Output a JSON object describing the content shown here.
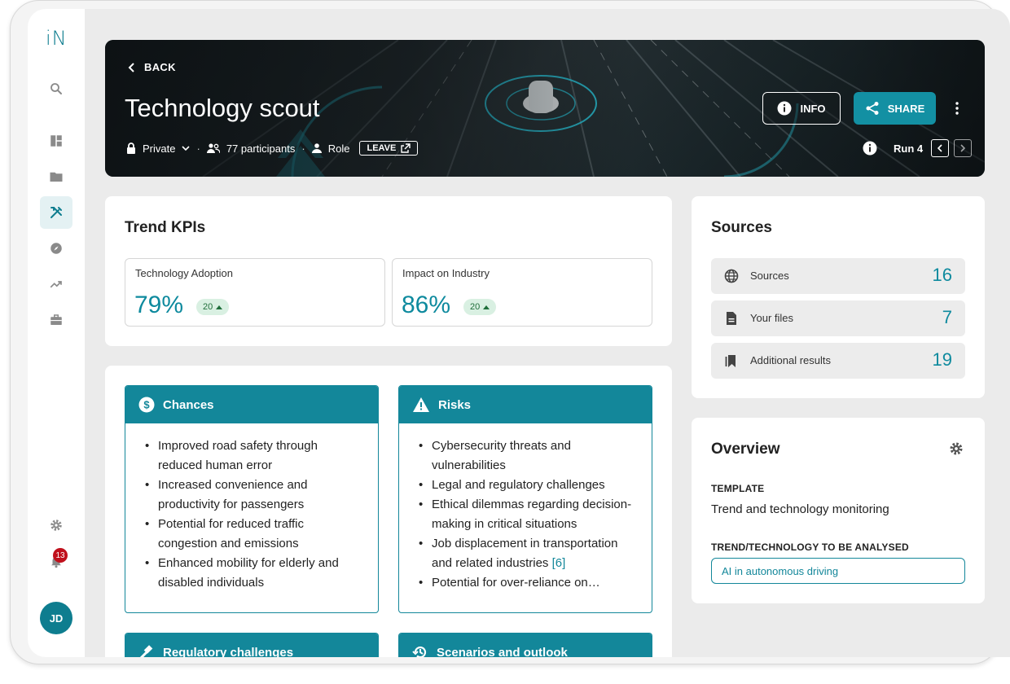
{
  "app": {
    "logo": "iN"
  },
  "sidebar": {
    "items": [
      {
        "icon": "search-icon"
      },
      {
        "icon": "dashboard-icon"
      },
      {
        "icon": "folder-icon"
      },
      {
        "icon": "tools-icon",
        "active": true
      },
      {
        "icon": "compass-icon"
      },
      {
        "icon": "trending-icon"
      },
      {
        "icon": "briefcase-icon"
      }
    ],
    "settings_icon": "gear-icon",
    "notifications": {
      "icon": "bell-icon",
      "count": "13"
    },
    "avatar_initials": "JD"
  },
  "header": {
    "back_label": "BACK",
    "title": "Technology scout",
    "privacy": "Private",
    "participants": "77 participants",
    "role": "Role",
    "leave_label": "LEAVE",
    "info_label": "INFO",
    "share_label": "SHARE",
    "run_label": "Run 4"
  },
  "kpis": {
    "title": "Trend KPIs",
    "items": [
      {
        "label": "Technology Adoption",
        "value": "79%",
        "delta": "20"
      },
      {
        "label": "Impact on Industry",
        "value": "86%",
        "delta": "20"
      }
    ]
  },
  "panels": {
    "chances": {
      "title": "Chances",
      "items": [
        "Improved road safety through reduced human error",
        "Increased convenience and productivity for passengers",
        "Potential for reduced traffic congestion and emissions",
        "Enhanced mobility for elderly and disabled individuals"
      ]
    },
    "risks": {
      "title": "Risks",
      "items": [
        "Cybersecurity threats and vulnerabilities",
        "Legal and regulatory challenges",
        "Ethical dilemmas regarding decision-making in critical situations",
        "Job displacement in transportation and related industries",
        "Potential for over-reliance on…"
      ],
      "ref": "[6]"
    },
    "regulatory": {
      "title": "Regulatory challenges"
    },
    "scenarios": {
      "title": "Scenarios and outlook"
    }
  },
  "sources": {
    "title": "Sources",
    "rows": [
      {
        "icon": "globe-icon",
        "label": "Sources",
        "count": "16"
      },
      {
        "icon": "file-icon",
        "label": "Your files",
        "count": "7"
      },
      {
        "icon": "bookmarks-icon",
        "label": "Additional results",
        "count": "19"
      }
    ]
  },
  "overview": {
    "title": "Overview",
    "template_label": "TEMPLATE",
    "template_value": "Trend and technology monitoring",
    "trend_label": "TREND/TECHNOLOGY TO BE ANALYSED",
    "trend_value": "AI in autonomous driving"
  },
  "colors": {
    "accent": "#13879a",
    "kpi_value": "#0e8a9e",
    "badge": "#c0101c"
  }
}
